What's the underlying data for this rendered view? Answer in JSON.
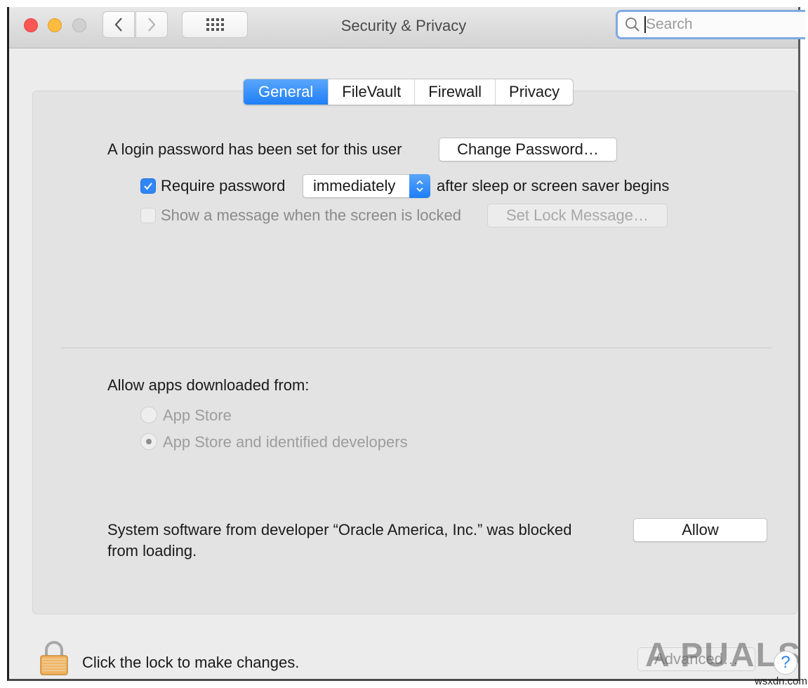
{
  "window": {
    "title": "Security & Privacy",
    "traffic_lights": [
      "close",
      "minimize",
      "zoom"
    ],
    "nav": {
      "back_icon": "chevron-left-icon",
      "forward_icon": "chevron-right-icon",
      "show_all_icon": "grid-icon"
    },
    "search": {
      "placeholder": "Search",
      "value": ""
    }
  },
  "tabs": [
    {
      "label": "General",
      "active": true
    },
    {
      "label": "FileVault",
      "active": false
    },
    {
      "label": "Firewall",
      "active": false
    },
    {
      "label": "Privacy",
      "active": false
    }
  ],
  "general": {
    "login_password_text": "A login password has been set for this user",
    "change_password_label": "Change Password…",
    "require_password": {
      "label": "Require password",
      "checked": true,
      "delay_selected": "immediately",
      "suffix": "after sleep or screen saver begins"
    },
    "lock_message": {
      "label": "Show a message when the screen is locked",
      "checked": false,
      "enabled": false,
      "button_label": "Set Lock Message…"
    },
    "allow_apps": {
      "heading": "Allow apps downloaded from:",
      "options": [
        {
          "label": "App Store",
          "selected": false
        },
        {
          "label": "App Store and identified developers",
          "selected": true
        }
      ],
      "enabled": false
    },
    "blocked_software": {
      "line1": "System software from developer “Oracle America, Inc.” was blocked",
      "line2": "from loading.",
      "allow_label": "Allow"
    }
  },
  "footer": {
    "lock_text": "Click the lock to make changes.",
    "advanced_label": "Advanced…",
    "help_label": "?"
  },
  "watermark": {
    "text": "A PUALS",
    "credit": "wsxdn.com"
  },
  "colors": {
    "accent": "#1e7ef7",
    "close": "#fc5753",
    "minimize": "#fdbc40",
    "zoom_inactive": "#d0d0d0",
    "search_focus": "#7fa9e0"
  }
}
